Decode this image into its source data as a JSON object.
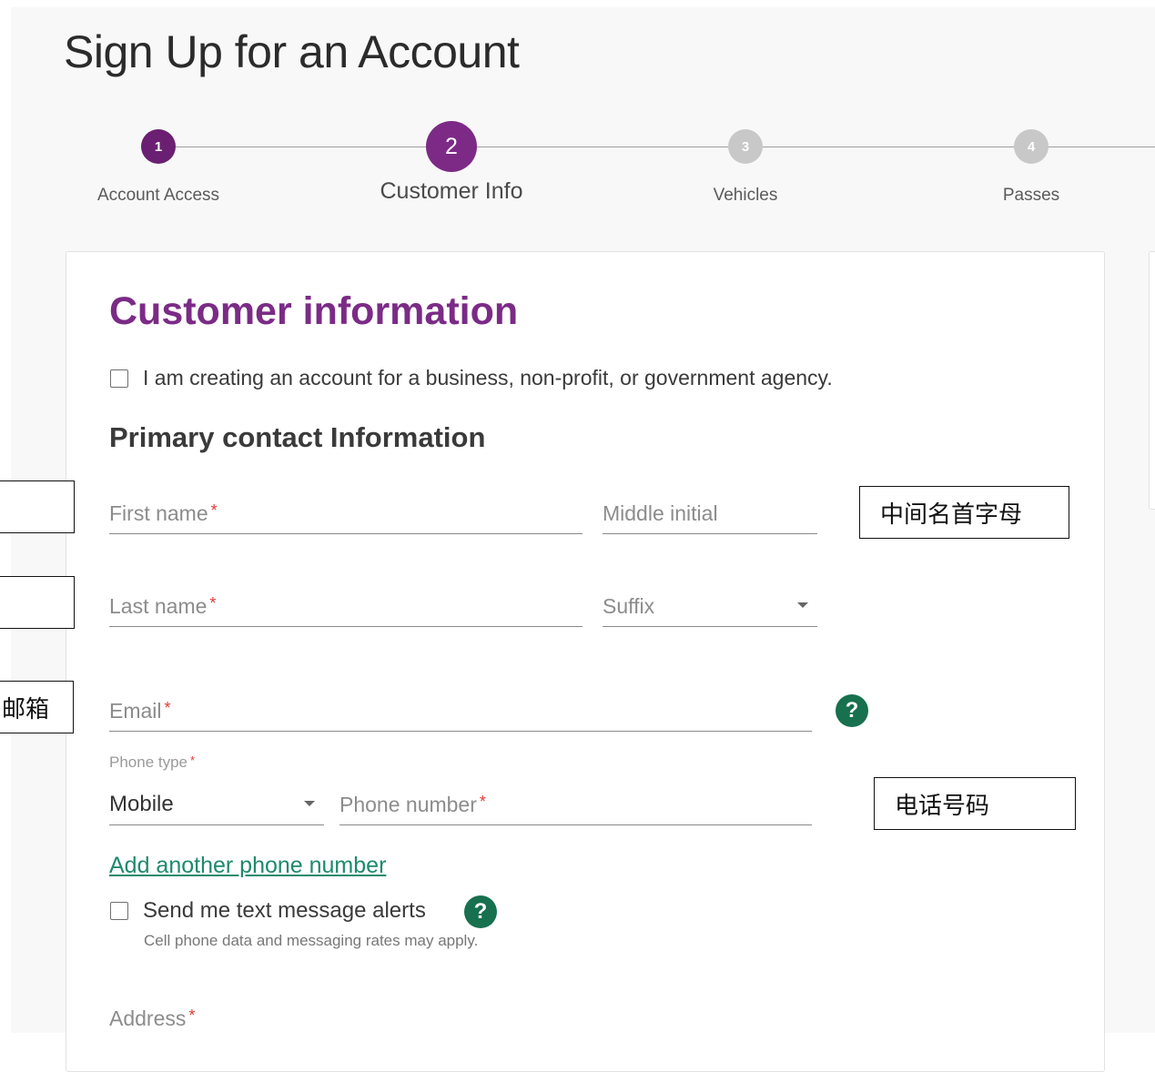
{
  "page": {
    "title": "Sign Up for an Account"
  },
  "stepper": {
    "steps": [
      {
        "number": "1",
        "label": "Account Access",
        "state": "done"
      },
      {
        "number": "2",
        "label": "Customer Info",
        "state": "active"
      },
      {
        "number": "3",
        "label": "Vehicles",
        "state": "future"
      },
      {
        "number": "4",
        "label": "Passes",
        "state": "future"
      }
    ]
  },
  "form": {
    "section_title": "Customer information",
    "business_checkbox_label": "I am creating an account for a business, non-profit, or government agency.",
    "primary_contact_title": "Primary contact Information",
    "first_name_label": "First name",
    "middle_initial_label": "Middle initial",
    "last_name_label": "Last name",
    "suffix_label": "Suffix",
    "email_label": "Email",
    "phone_type_label": "Phone type",
    "phone_type_value": "Mobile",
    "phone_number_label": "Phone number",
    "add_phone_link": "Add another phone number",
    "text_alerts_label": "Send me text message alerts",
    "text_alerts_hint": "Cell phone data and messaging rates may apply.",
    "address_label": "Address",
    "required_mark": "*",
    "help_glyph": "?"
  },
  "annotations": {
    "middle_initial": "中间名首字母",
    "email": "邮箱",
    "phone_number": "电话号码"
  },
  "colors": {
    "brand_purple": "#7b2b86",
    "help_green": "#17704e",
    "link_green": "#1e8a6b",
    "required_red": "#e53935"
  }
}
